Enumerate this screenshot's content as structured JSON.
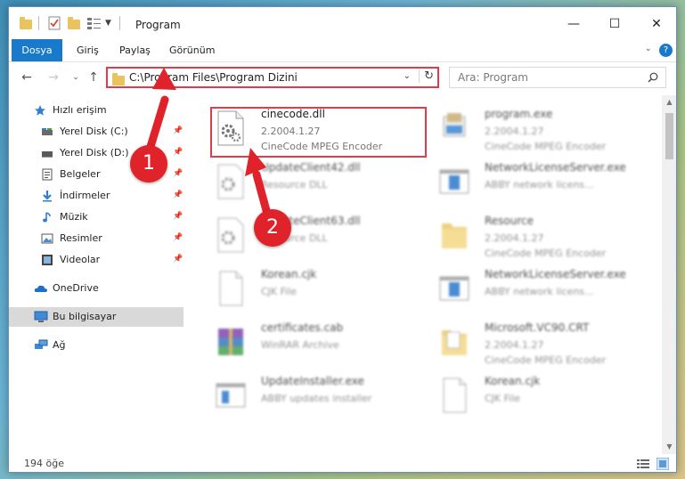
{
  "window": {
    "title": "Program",
    "controls": {
      "minimize": "—",
      "maximize": "☐",
      "close": "✕"
    }
  },
  "ribbon": {
    "tabs": [
      {
        "label": "Dosya",
        "active": true
      },
      {
        "label": "Giriş"
      },
      {
        "label": "Paylaş"
      },
      {
        "label": "Görünüm"
      }
    ],
    "help": "?"
  },
  "address_bar": {
    "path": "C:\\Program Files\\Program Dizini",
    "search_placeholder": "Ara: Program"
  },
  "sidebar": {
    "items": [
      {
        "label": "Hızlı erişim",
        "icon": "star-icon"
      },
      {
        "label": "Yerel Disk (C:)",
        "icon": "drive-icon",
        "pinned": true
      },
      {
        "label": "Yerel Disk (D:)",
        "icon": "drive-icon",
        "pinned": true
      },
      {
        "label": "Belgeler",
        "icon": "documents-icon",
        "pinned": true
      },
      {
        "label": "İndirmeler",
        "icon": "download-icon",
        "pinned": true
      },
      {
        "label": "Müzik",
        "icon": "music-icon",
        "pinned": true
      },
      {
        "label": "Resimler",
        "icon": "pictures-icon",
        "pinned": true
      },
      {
        "label": "Videolar",
        "icon": "videos-icon",
        "pinned": true
      },
      {
        "label": "OneDrive",
        "icon": "cloud-icon"
      },
      {
        "label": "Bu bilgisayar",
        "icon": "computer-icon",
        "selected": true
      },
      {
        "label": "Ağ",
        "icon": "network-icon"
      }
    ]
  },
  "files": [
    {
      "name": "cinecode.dll",
      "meta1": "2.2004.1.27",
      "meta2": "CineCode MPEG Encoder",
      "icon": "dll-gear-icon",
      "highlighted": true
    },
    {
      "name": "program.exe",
      "meta1": "2.2004.1.27",
      "meta2": "CineCode MPEG Encoder",
      "icon": "exe-icon"
    },
    {
      "name": "UpdateClient42.dll",
      "meta1": "Resource DLL",
      "meta2": "",
      "icon": "dll-gear-icon"
    },
    {
      "name": "NetworkLicenseServer.exe",
      "meta1": "ABBY network licens...",
      "meta2": "",
      "icon": "exe-window-icon"
    },
    {
      "name": "UpdateClient63.dll",
      "meta1": "Resource DLL",
      "meta2": "",
      "icon": "dll-gear-icon"
    },
    {
      "name": "Resource",
      "meta1": "2.2004.1.27",
      "meta2": "CineCode MPEG Encoder",
      "icon": "folder-icon"
    },
    {
      "name": "Korean.cjk",
      "meta1": "CJK File",
      "meta2": "",
      "icon": "blank-file-icon"
    },
    {
      "name": "NetworkLicenseServer.exe",
      "meta1": "ABBY network licens...",
      "meta2": "",
      "icon": "exe-window-icon"
    },
    {
      "name": "certificates.cab",
      "meta1": "WinRAR Archive",
      "meta2": "",
      "icon": "archive-icon"
    },
    {
      "name": "Microsoft.VC90.CRT",
      "meta1": "2.2004.1.27",
      "meta2": "CineCode MPEG Encoder",
      "icon": "folder-icon"
    },
    {
      "name": "UpdateInstaller.exe",
      "meta1": "ABBY updates installer",
      "meta2": "",
      "icon": "exe-window-icon"
    },
    {
      "name": "Korean.cjk",
      "meta1": "CJK File",
      "meta2": "",
      "icon": "blank-file-icon"
    }
  ],
  "status": {
    "count": "194 öğe"
  },
  "annotations": {
    "step1": "1",
    "step2": "2"
  },
  "colors": {
    "accent": "#1979ca",
    "highlight": "#e23c4b",
    "badge": "#e0222a"
  }
}
